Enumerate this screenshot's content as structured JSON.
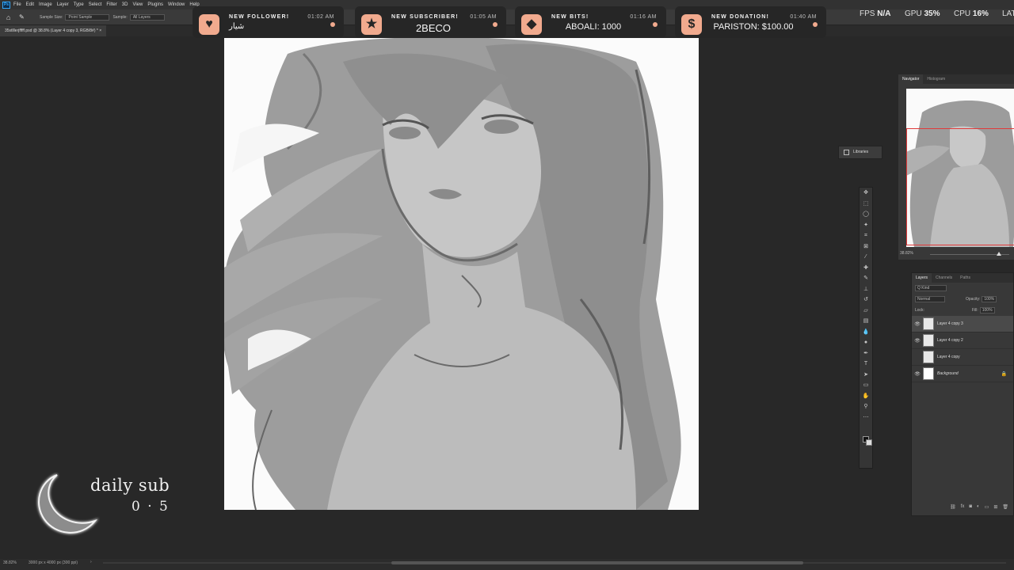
{
  "menubar": {
    "logo": "Ps",
    "items": [
      "File",
      "Edit",
      "Image",
      "Layer",
      "Type",
      "Select",
      "Filter",
      "3D",
      "View",
      "Plugins",
      "Window",
      "Help"
    ]
  },
  "options": {
    "sample_size_label": "Sample Size:",
    "sample_size_value": "Point Sample",
    "sample_label": "Sample:",
    "sample_value": "All Layers"
  },
  "document_tab": {
    "title": "35stlllerjfffff.psd @ 38.8% (Layer 4 copy 3, RGB/8#) *  ×"
  },
  "alerts": [
    {
      "type": "NEW FOLLOWER!",
      "time": "01:02 AM",
      "value": "شیار",
      "icon": "heart-icon"
    },
    {
      "type": "NEW SUBSCRIBER!",
      "time": "01:05 AM",
      "value": "2BECO",
      "icon": "star-icon"
    },
    {
      "type": "NEW BITS!",
      "time": "01:16 AM",
      "value": "ABOALI: 1000",
      "icon": "diamond-icon"
    },
    {
      "type": "NEW DONATION!",
      "time": "01:40 AM",
      "value": "PARISTON: $100.00",
      "icon": "dollar-icon"
    }
  ],
  "perf": {
    "fps_label": "FPS",
    "fps_value": "N/A",
    "gpu_label": "GPU",
    "gpu_value": "35%",
    "cpu_label": "CPU",
    "cpu_value": "16%",
    "extra": "LAT"
  },
  "libraries": {
    "label": "Libraries"
  },
  "navigator": {
    "tab_active": "Navigator",
    "tab_other": "Histogram",
    "zoom": "38.82%"
  },
  "layers": {
    "tabs": [
      "Layers",
      "Channels",
      "Paths"
    ],
    "kind_label": "Q Kind",
    "blend_mode": "Normal",
    "opacity_label": "Opacity:",
    "opacity_value": "100%",
    "lock_label": "Lock:",
    "fill_label": "Fill:",
    "fill_value": "100%",
    "rows": [
      {
        "name": "Layer 4 copy 3",
        "visible": true,
        "active": true
      },
      {
        "name": "Layer 4 copy 2",
        "visible": true,
        "active": false
      },
      {
        "name": "Layer 4 copy",
        "visible": false,
        "active": false
      },
      {
        "name": "Background",
        "visible": true,
        "active": false,
        "locked": true
      }
    ]
  },
  "daily_sub": {
    "title": "daily sub",
    "count": "0 · 5"
  },
  "status": {
    "zoom": "38.82%",
    "doc_info": "3000 px x 4000 px (300 ppi)",
    "arrow": "›"
  },
  "colors": {
    "accent": "#f1aa8e",
    "panel": "#383838",
    "canvas_bg": "#282828"
  }
}
